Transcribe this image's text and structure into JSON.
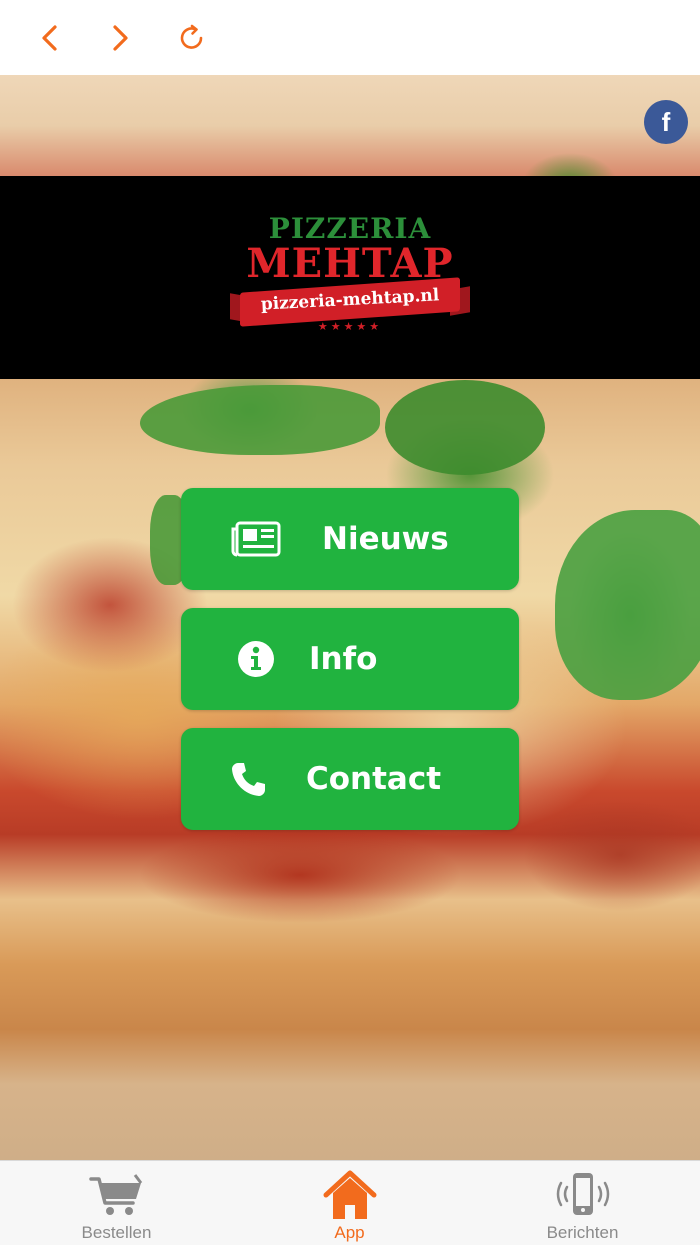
{
  "browser": {
    "back_icon": "chevron-left-icon",
    "forward_icon": "chevron-right-icon",
    "reload_icon": "reload-icon",
    "accent": "#f26b1d"
  },
  "social": {
    "facebook_label": "f",
    "color": "#3b5998"
  },
  "logo": {
    "line1": "PIZZERIA",
    "line2": "MEHTAP",
    "url": "pizzeria-mehtap.nl",
    "stars": "★★★★★"
  },
  "menu": {
    "color": "#21b33f",
    "items": [
      {
        "label": "Nieuws",
        "icon": "newspaper-icon"
      },
      {
        "label": "Info",
        "icon": "info-icon"
      },
      {
        "label": "Contact",
        "icon": "phone-icon"
      }
    ]
  },
  "tabbar": {
    "items": [
      {
        "label": "Bestellen",
        "icon": "cart-icon",
        "active": false
      },
      {
        "label": "App",
        "icon": "home-icon",
        "active": true
      },
      {
        "label": "Berichten",
        "icon": "phone-vibrate-icon",
        "active": false
      }
    ]
  }
}
